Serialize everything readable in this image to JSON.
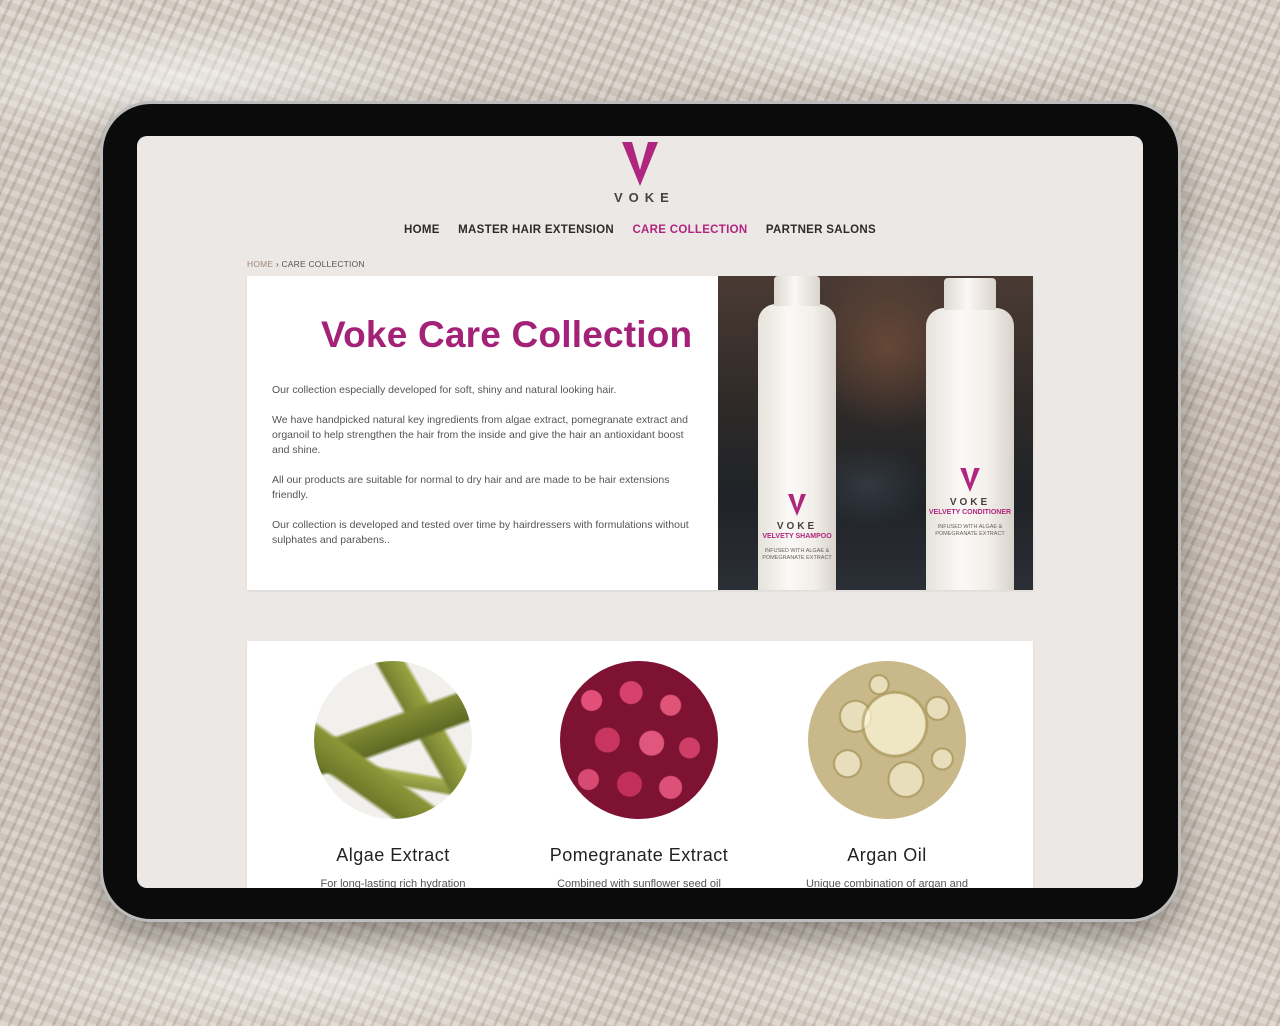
{
  "brand": {
    "name": "VOKE",
    "accent_color": "#b0267e"
  },
  "nav": {
    "items": [
      {
        "label": "HOME",
        "active": false
      },
      {
        "label": "MASTER HAIR EXTENSION",
        "active": false
      },
      {
        "label": "CARE COLLECTION",
        "active": true
      },
      {
        "label": "PARTNER SALONS",
        "active": false
      }
    ]
  },
  "breadcrumb": {
    "home": "HOME",
    "separator": "›",
    "current": "CARE COLLECTION"
  },
  "hero": {
    "title": "Voke Care Collection",
    "paragraphs": [
      "Our collection especially developed for soft, shiny and natural looking hair.",
      "We have handpicked natural key ingredients from algae extract, pomegranate extract and organoil to help strengthen the hair from the inside and give the hair an antioxidant boost and shine.",
      "All our products are suitable for normal to dry hair and are made to be hair extensions friendly.",
      "Our collection is developed and tested over time by hairdressers with formulations without sulphates and parabens.."
    ],
    "photo": {
      "bottle_left": {
        "brand": "VOKE",
        "name": "VELVETY SHAMPOO",
        "sub": "INFUSED WITH ALGAE & POMEGRANATE EXTRACT"
      },
      "bottle_right": {
        "brand": "VOKE",
        "name": "VELVETY CONDITIONER",
        "sub": "INFUSED WITH ALGAE & POMEGRANATE EXTRACT"
      }
    }
  },
  "ingredients": [
    {
      "title": "Algae Extract",
      "desc": "For long-lasting rich hydration",
      "icon": "algae-image"
    },
    {
      "title": "Pomegranate Extract",
      "desc": "Combined with sunflower seed oil",
      "icon": "pomegranate-image"
    },
    {
      "title": "Argan Oil",
      "desc": "Unique combination of argan and",
      "icon": "argan-oil-image"
    }
  ]
}
